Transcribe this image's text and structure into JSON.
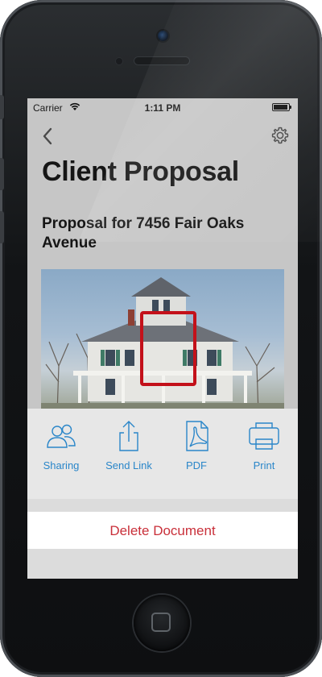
{
  "status_bar": {
    "carrier": "Carrier",
    "time": "1:11 PM",
    "wifi_icon": "wifi-icon",
    "battery_icon": "battery-icon"
  },
  "nav": {
    "back_icon": "chevron-left-icon",
    "settings_icon": "gear-icon"
  },
  "document": {
    "title": "Client Proposal",
    "subtitle": "Proposal for 7456 Fair Oaks Avenue",
    "photo_description_icon": "house-photo"
  },
  "action_sheet": {
    "actions": [
      {
        "label": "Sharing",
        "icon": "people-icon"
      },
      {
        "label": "Send Link",
        "icon": "share-upload-icon"
      },
      {
        "label": "PDF",
        "icon": "pdf-document-icon"
      },
      {
        "label": "Print",
        "icon": "printer-icon"
      }
    ],
    "delete_label": "Delete Document"
  },
  "colors": {
    "accent_blue": "#2a86c9",
    "destructive_red": "#c9303a",
    "highlight_red": "#c3111a"
  }
}
